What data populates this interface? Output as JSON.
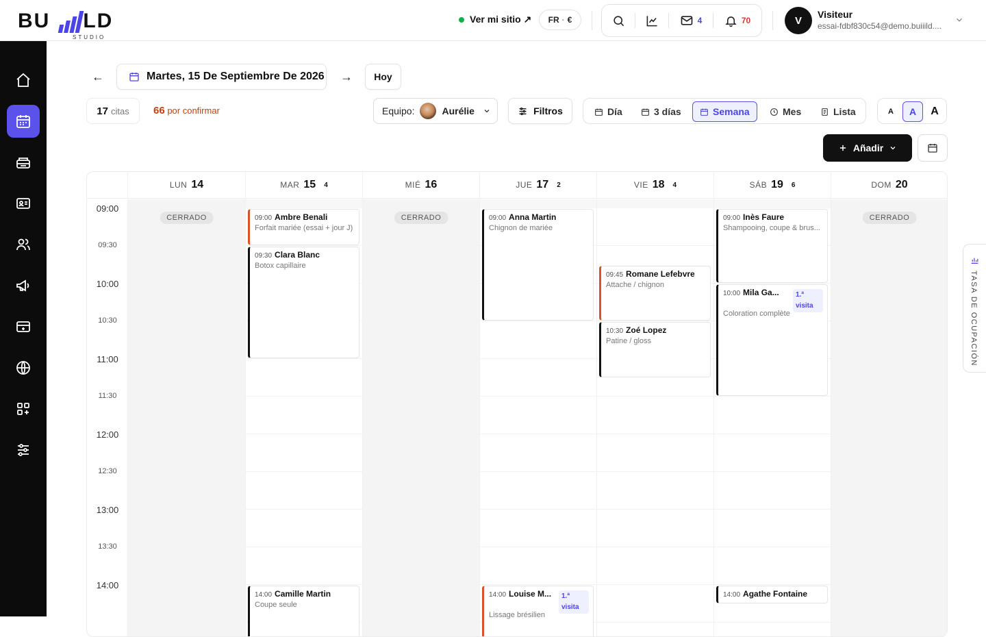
{
  "brand": {
    "logo_text_left": "BU",
    "logo_text_right": "LD",
    "logo_sub": "STUDIO",
    "accent": "#4b44e6"
  },
  "topbar": {
    "site_link": "Ver mi sitio ↗",
    "locale": "FR",
    "currency": "€",
    "mail_count": "4",
    "notif_count": "70",
    "user": {
      "initial": "V",
      "name": "Visiteur",
      "email": "essai-fdbf830c54@demo.buiiild...."
    }
  },
  "sidebar": {
    "items": [
      "home-icon",
      "calendar-icon",
      "register-icon",
      "contact-card-icon",
      "users-icon",
      "megaphone-icon",
      "payment-card-icon",
      "globe-icon",
      "apps-icon",
      "sliders-icon"
    ],
    "active": "calendar-icon"
  },
  "toolbar": {
    "current_date": "Martes, 15 De Septiembre De 2026",
    "prev_arrow": "←",
    "next_arrow": "→",
    "today": "Hoy",
    "appointments_count": "17",
    "appointments_label": "citas",
    "pending_count": "66",
    "pending_label": "por confirmar",
    "team_label": "Equipo:",
    "team_member": "Aurélie",
    "filters": "Filtros",
    "views": [
      {
        "label": "Día",
        "active": false
      },
      {
        "label": "3 días",
        "active": false
      },
      {
        "label": "Semana",
        "active": true
      },
      {
        "label": "Mes",
        "active": false
      },
      {
        "label": "Lista",
        "active": false
      }
    ],
    "font_sizes": [
      "A",
      "A",
      "A"
    ],
    "add": "Añadir"
  },
  "calendar": {
    "closed_label": "CERRADO",
    "days": [
      {
        "name": "LUN",
        "num": "14",
        "count": "",
        "closed": true
      },
      {
        "name": "MAR",
        "num": "15",
        "count": "4",
        "closed": false
      },
      {
        "name": "MIÉ",
        "num": "16",
        "count": "",
        "closed": true
      },
      {
        "name": "JUE",
        "num": "17",
        "count": "2",
        "closed": false
      },
      {
        "name": "VIE",
        "num": "18",
        "count": "4",
        "closed": false
      },
      {
        "name": "SÁB",
        "num": "19",
        "count": "6",
        "closed": false
      },
      {
        "name": "DOM",
        "num": "20",
        "count": "",
        "closed": true
      }
    ],
    "times": [
      "09:00",
      "09:30",
      "10:00",
      "10:30",
      "11:00",
      "11:30",
      "12:00",
      "12:30",
      "13:00",
      "13:30",
      "14:00"
    ],
    "appointments": [
      {
        "day": 1,
        "start": "09:00",
        "duration_min": 30,
        "time": "09:00",
        "name": "Ambre Benali",
        "service": "Forfait mariée (essai + jour J)",
        "color": "orange",
        "badge": ""
      },
      {
        "day": 1,
        "start": "09:30",
        "duration_min": 90,
        "time": "09:30",
        "name": "Clara Blanc",
        "service": "Botox capillaire",
        "color": "dark",
        "badge": ""
      },
      {
        "day": 1,
        "start": "14:00",
        "duration_min": 60,
        "time": "14:00",
        "name": "Camille Martin",
        "service": "Coupe seule",
        "color": "dark",
        "badge": ""
      },
      {
        "day": 3,
        "start": "09:00",
        "duration_min": 90,
        "time": "09:00",
        "name": "Anna Martin",
        "service": "Chignon de mariée",
        "color": "dark",
        "badge": ""
      },
      {
        "day": 3,
        "start": "14:00",
        "duration_min": 60,
        "time": "14:00",
        "name": "Louise M...",
        "service": "Lissage brésilien",
        "color": "orange",
        "badge": "1.ª visita"
      },
      {
        "day": 4,
        "start": "09:45",
        "duration_min": 45,
        "time": "09:45",
        "name": "Romane Lefebvre",
        "service": "Attache / chignon",
        "color": "orange",
        "badge": ""
      },
      {
        "day": 4,
        "start": "10:30",
        "duration_min": 45,
        "time": "10:30",
        "name": "Zoé Lopez",
        "service": "Patine / gloss",
        "color": "dark",
        "badge": ""
      },
      {
        "day": 5,
        "start": "09:00",
        "duration_min": 60,
        "time": "09:00",
        "name": "Inès Faure",
        "service": "Shampooing, coupe & brus...",
        "color": "dark",
        "badge": ""
      },
      {
        "day": 5,
        "start": "10:00",
        "duration_min": 90,
        "time": "10:00",
        "name": "Mila Ga...",
        "service": "Coloration complète",
        "color": "dark",
        "badge": "1.ª visita"
      },
      {
        "day": 5,
        "start": "14:00",
        "duration_min": 15,
        "time": "14:00",
        "name": "Agathe Fontaine",
        "service": "",
        "color": "dark",
        "badge": ""
      }
    ]
  },
  "occupancy_tab": "TASA DE OCUPACIÓN"
}
